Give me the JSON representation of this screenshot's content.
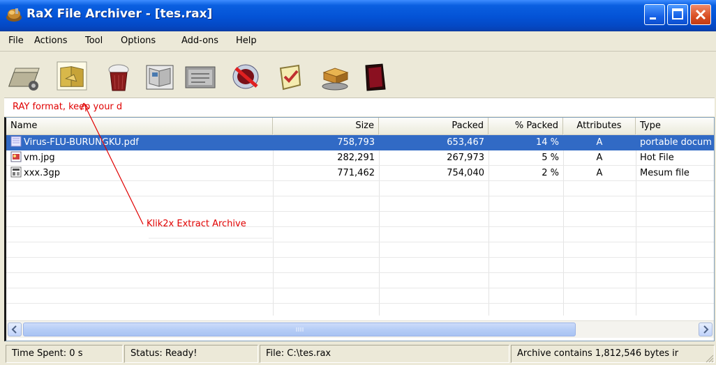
{
  "window": {
    "title": "RaX File Archiver - [tes.rax]"
  },
  "menu": {
    "items": [
      "File",
      "Actions",
      "Tool",
      "Options",
      "Add-ons",
      "Help"
    ]
  },
  "toolbar": {
    "buttons": [
      "add-files-icon",
      "extract-archive-icon",
      "delete-icon",
      "view-icon",
      "info-icon",
      "virus-scan-icon",
      "test-archive-icon",
      "install-icon",
      "exit-icon"
    ]
  },
  "info_strip": {
    "text": "RAY format, keep your d"
  },
  "file_list": {
    "columns": [
      "Name",
      "Size",
      "Packed",
      "% Packed",
      "Attributes",
      "Type"
    ],
    "rows": [
      {
        "name": "Virus-FLU-BURUNGKU.pdf",
        "size": "758,793",
        "packed": "653,467",
        "pct": "14 %",
        "attr": "A",
        "type": "portable docum",
        "icon": "pdf-file-icon"
      },
      {
        "name": "vm.jpg",
        "size": "282,291",
        "packed": "267,973",
        "pct": "5 %",
        "attr": "A",
        "type": "Hot File",
        "icon": "image-file-icon"
      },
      {
        "name": "xxx.3gp",
        "size": "771,462",
        "packed": "754,040",
        "pct": "2 %",
        "attr": "A",
        "type": "Mesum file",
        "icon": "video-file-icon"
      }
    ]
  },
  "annotation": {
    "text": "Klik2x Extract Archive"
  },
  "status": {
    "time": "Time Spent: 0 s",
    "state": "Status: Ready!",
    "file": "File: C:\\tes.rax",
    "summary": "Archive contains 1,812,546 bytes ir"
  },
  "colors": {
    "selection": "#316ac5",
    "annotation": "#e00000",
    "titlebar": "#0453d6"
  }
}
